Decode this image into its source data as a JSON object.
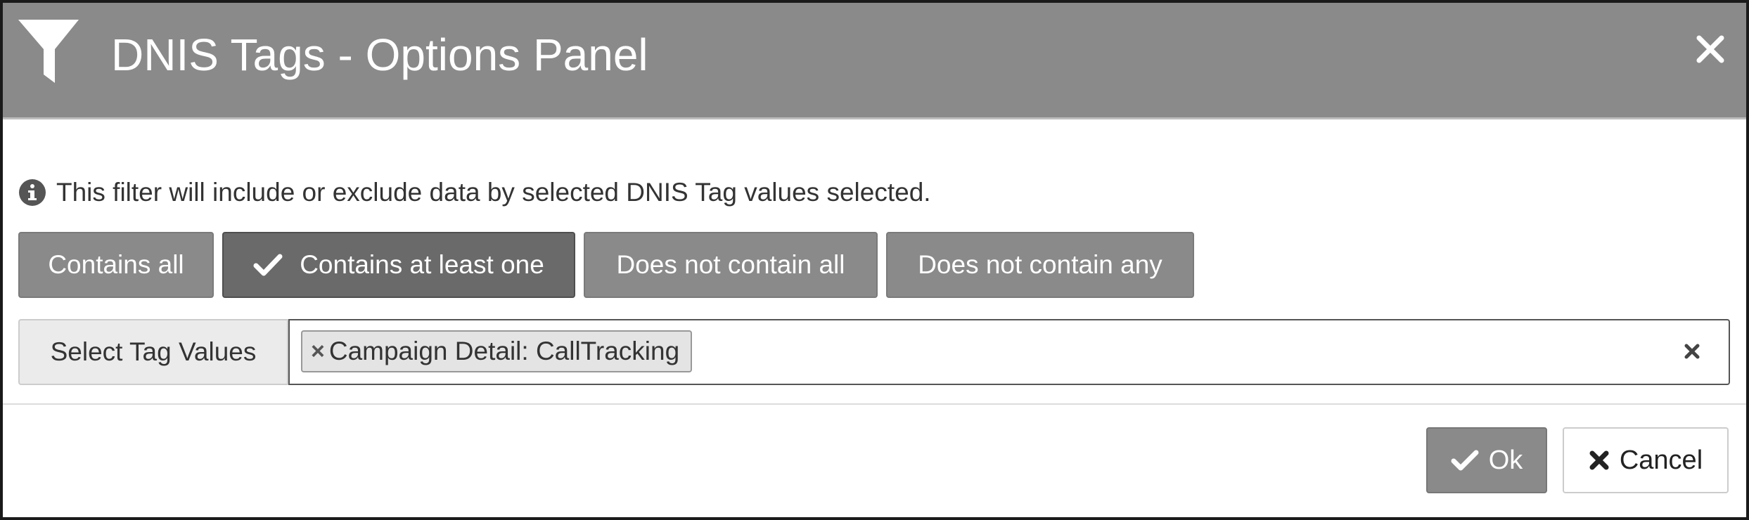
{
  "dialog": {
    "title": "DNIS Tags - Options Panel",
    "header_icon": "filter-icon",
    "close_icon": "close-icon"
  },
  "info": {
    "icon": "info-icon",
    "text": "This filter will include or exclude data by selected DNIS Tag values selected."
  },
  "modes": [
    {
      "label": "Contains all",
      "selected": false
    },
    {
      "label": "Contains at least one",
      "selected": true
    },
    {
      "label": "Does not contain all",
      "selected": false
    },
    {
      "label": "Does not contain any",
      "selected": false
    }
  ],
  "tag_select": {
    "label": "Select Tag Values",
    "selected_tags": [
      {
        "remove_symbol": "×",
        "label": "Campaign Detail: CallTracking"
      }
    ],
    "clear_icon": "clear-icon"
  },
  "footer": {
    "ok_label": "Ok",
    "cancel_label": "Cancel"
  },
  "colors": {
    "header_bg": "#8a8a8a",
    "button_bg": "#8a8a8a",
    "button_active_bg": "#6a6a6a"
  }
}
